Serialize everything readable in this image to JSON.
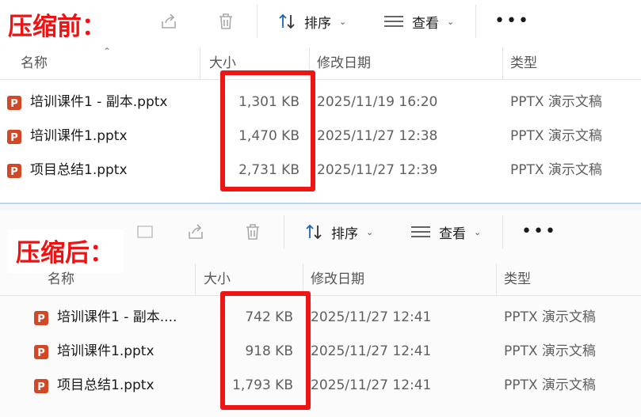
{
  "before": {
    "title": "压缩前：",
    "toolbar": {
      "sort_label": "排序",
      "view_label": "查看",
      "more_label": "•••"
    },
    "columns": {
      "name": "名称",
      "size": "大小",
      "date": "修改日期",
      "type": "类型"
    },
    "files": [
      {
        "name": "培训课件1 - 副本.pptx",
        "size": "1,301 KB",
        "date": "2025/11/19 16:20",
        "type": "PPTX 演示文稿"
      },
      {
        "name": "培训课件1.pptx",
        "size": "1,470 KB",
        "date": "2025/11/27 12:38",
        "type": "PPTX 演示文稿"
      },
      {
        "name": "项目总结1.pptx",
        "size": "2,731 KB",
        "date": "2025/11/27 12:39",
        "type": "PPTX 演示文稿"
      }
    ]
  },
  "after": {
    "title": "压缩后：",
    "toolbar": {
      "sort_label": "排序",
      "view_label": "查看",
      "more_label": "•••"
    },
    "columns": {
      "name": "名称",
      "size": "大小",
      "date": "修改日期",
      "type": "类型"
    },
    "files": [
      {
        "name": "培训课件1 - 副本....",
        "size": "742 KB",
        "date": "2025/11/27 12:41",
        "type": "PPTX 演示文稿"
      },
      {
        "name": "培训课件1.pptx",
        "size": "918 KB",
        "date": "2025/11/27 12:41",
        "type": "PPTX 演示文稿"
      },
      {
        "name": "项目总结1.pptx",
        "size": "1,793 KB",
        "date": "2025/11/27 12:41",
        "type": "PPTX 演示文稿"
      }
    ]
  },
  "colors": {
    "title_red": "#f01212",
    "highlight_red": "#ee1515",
    "ppt_orange": "#d24726",
    "accent_blue": "#1e63b8"
  }
}
